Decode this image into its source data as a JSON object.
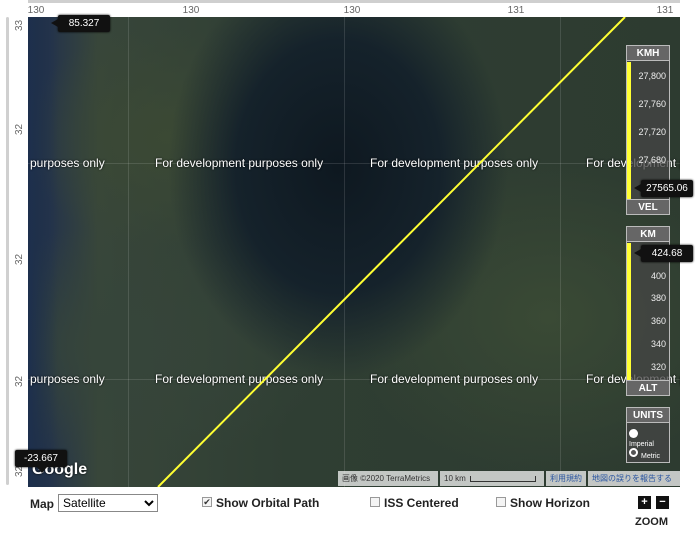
{
  "axes": {
    "top_ticks": [
      "130",
      "130",
      "130",
      "131",
      "131"
    ],
    "left_ticks": [
      "33",
      "32",
      "32",
      "32",
      "32"
    ]
  },
  "map": {
    "watermark": "For development purposes only",
    "watermark_fragments": [
      "purposes only",
      "For development p"
    ],
    "logo": "Google",
    "attribution": "画像 ©2020 TerraMetrics",
    "scale": "10 km",
    "terms": "利用規約",
    "report": "地図の誤りを報告する",
    "orbit_color": "#ffff33"
  },
  "markers": {
    "top_left": "85.327",
    "bottom_left": "-23.667"
  },
  "velocity_gauge": {
    "unit": "KMH",
    "footer": "VEL",
    "ticks": [
      "27,800",
      "27,760",
      "27,720",
      "27,680"
    ],
    "value": "27565.06"
  },
  "altitude_gauge": {
    "unit": "KM",
    "footer": "ALT",
    "ticks": [
      "400",
      "380",
      "360",
      "340",
      "320"
    ],
    "value": "424.68"
  },
  "units_panel": {
    "title": "UNITS",
    "options": [
      "Imperial",
      "Metric"
    ],
    "selected": "Metric"
  },
  "controls": {
    "map_label": "Map",
    "map_type": "Satellite",
    "show_orbital_path": "Show Orbital Path",
    "iss_centered": "ISS Centered",
    "show_horizon": "Show Horizon",
    "zoom_label": "ZOOM",
    "zoom_in": "+",
    "zoom_out": "−",
    "checked": {
      "orbital_path": true,
      "iss_centered": false,
      "horizon": false
    }
  }
}
